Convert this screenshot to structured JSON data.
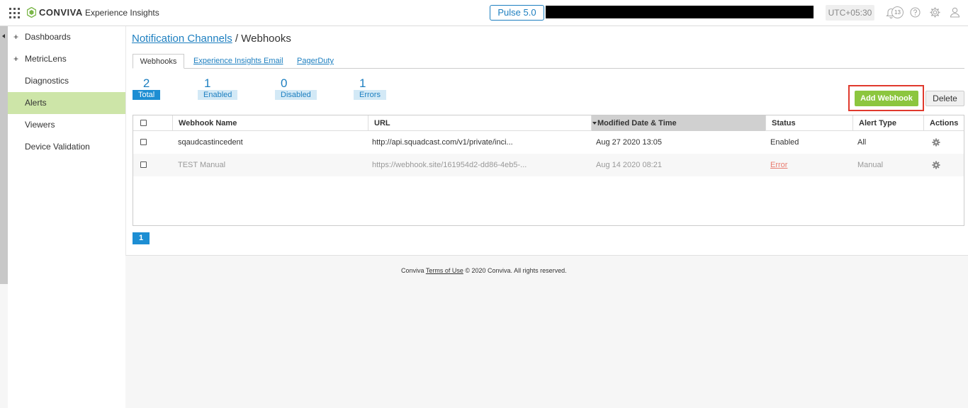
{
  "header": {
    "brand": "CONVIVA",
    "product": "Experience Insights",
    "pulse_label": "Pulse 5.0",
    "timezone": "UTC+05:30",
    "notification_count": "13"
  },
  "sidebar": {
    "items": [
      {
        "label": "Dashboards",
        "expandable": true,
        "active": false
      },
      {
        "label": "MetricLens",
        "expandable": true,
        "active": false
      },
      {
        "label": "Diagnostics",
        "expandable": false,
        "active": false
      },
      {
        "label": "Alerts",
        "expandable": false,
        "active": true
      },
      {
        "label": "Viewers",
        "expandable": false,
        "active": false
      },
      {
        "label": "Device Validation",
        "expandable": false,
        "active": false
      }
    ],
    "plus_glyph": "+"
  },
  "breadcrumb": {
    "parent": "Notification Channels",
    "separator": "/",
    "current": "Webhooks"
  },
  "tabs": [
    "Webhooks",
    "Experience Insights Email",
    "PagerDuty"
  ],
  "stats": [
    {
      "value": "2",
      "label": "Total"
    },
    {
      "value": "1",
      "label": "Enabled"
    },
    {
      "value": "0",
      "label": "Disabled"
    },
    {
      "value": "1",
      "label": "Errors"
    }
  ],
  "actions": {
    "add_label": "Add Webhook",
    "delete_label": "Delete"
  },
  "table": {
    "columns": [
      "Webhook Name",
      "URL",
      "Modified Date & Time",
      "Status",
      "Alert Type",
      "Actions"
    ],
    "sorted_column": "Modified Date & Time",
    "rows": [
      {
        "name": "sqaudcastincedent",
        "url": "http://api.squadcast.com/v1/private/inci...",
        "modified": "Aug 27 2020 13:05",
        "status": "Enabled",
        "alert_type": "All"
      },
      {
        "name": "TEST Manual",
        "url": "https://webhook.site/161954d2-dd86-4eb5-...",
        "modified": "Aug 14 2020 08:21",
        "status": "Error",
        "alert_type": "Manual"
      }
    ]
  },
  "pagination": {
    "current_page": "1"
  },
  "footer": {
    "prefix": "Conviva",
    "terms_link": "Terms of Use",
    "suffix": "© 2020 Conviva. All rights reserved."
  },
  "colors": {
    "accent": "#1d7fc0",
    "add_button": "#8cc63f",
    "active_nav": "#cde5a8",
    "highlight_frame": "#e0392d",
    "error": "#e87b6f"
  }
}
